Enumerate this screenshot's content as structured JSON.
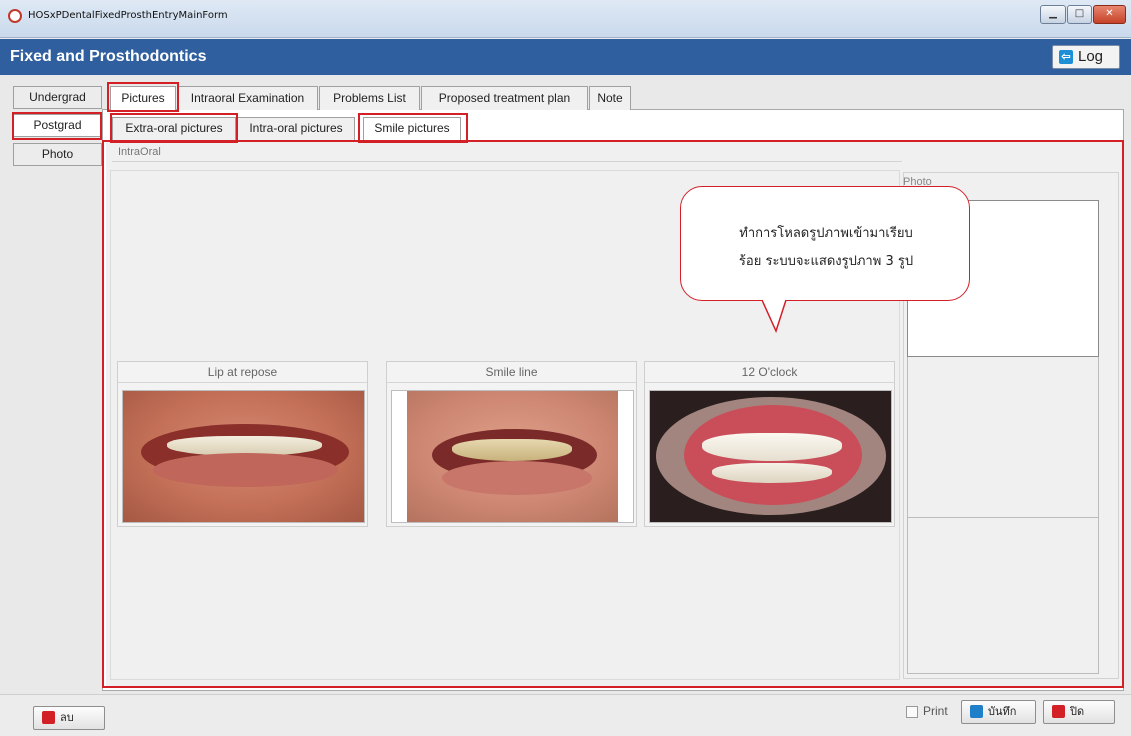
{
  "window": {
    "title": "HOSxPDentalFixedProsthEntryMainForm"
  },
  "header": {
    "title": "Fixed and Prosthodontics",
    "log_label": "Log"
  },
  "left_tabs": [
    {
      "label": "Undergrad"
    },
    {
      "label": "Postgrad",
      "active": true
    },
    {
      "label": "Photo"
    }
  ],
  "main_tabs": [
    {
      "label": "Pictures",
      "active": true
    },
    {
      "label": "Intraoral Examination"
    },
    {
      "label": "Problems List"
    },
    {
      "label": "Proposed treatment plan"
    },
    {
      "label": "Note"
    }
  ],
  "sub_tabs": [
    {
      "label": "Extra-oral pictures"
    },
    {
      "label": "Intra-oral pictures"
    },
    {
      "label": "Smile pictures",
      "active": true
    }
  ],
  "group": {
    "label": "IntraOral"
  },
  "pictures": [
    {
      "title": "Lip at repose"
    },
    {
      "title": "Smile line"
    },
    {
      "title": "12 O'clock"
    }
  ],
  "photo_panel": {
    "label": "Photo"
  },
  "callout": {
    "line1": "ทำการโหลดรูปภาพเข้ามาเรียบ",
    "line2": "ร้อย ระบบจะแสดงรูปภาพ 3 รูป"
  },
  "bottom": {
    "delete_label": "ลบ",
    "print_label": "Print",
    "save_label": "บันทึก",
    "close_label": "ปิด"
  },
  "colors": {
    "header_bg": "#2f5f9f",
    "highlight": "#d32027"
  }
}
